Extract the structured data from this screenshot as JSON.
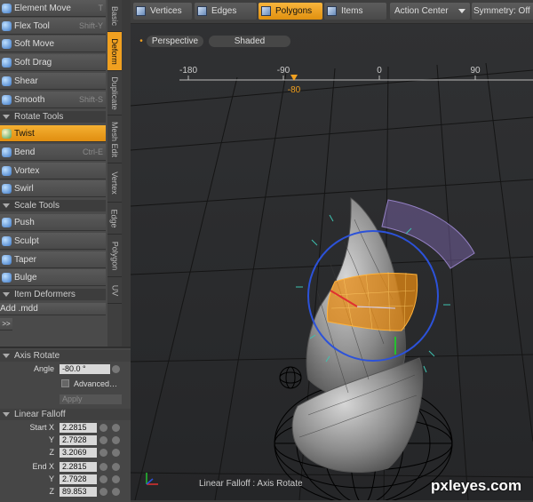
{
  "tool_panel": {
    "tools_top": [
      {
        "label": "Element Move",
        "shortcut": "T"
      },
      {
        "label": "Flex Tool",
        "shortcut": "Shift-Y"
      },
      {
        "label": "Soft Move",
        "shortcut": ""
      },
      {
        "label": "Soft Drag",
        "shortcut": ""
      },
      {
        "label": "Shear",
        "shortcut": ""
      },
      {
        "label": "Smooth",
        "shortcut": "Shift-S"
      }
    ],
    "rotate_header": "Rotate Tools",
    "rotate_tools": [
      {
        "label": "Twist",
        "shortcut": ""
      },
      {
        "label": "Bend",
        "shortcut": "Ctrl-E"
      },
      {
        "label": "Vortex",
        "shortcut": ""
      },
      {
        "label": "Swirl",
        "shortcut": ""
      }
    ],
    "scale_header": "Scale Tools",
    "scale_tools": [
      {
        "label": "Push"
      },
      {
        "label": "Sculpt"
      },
      {
        "label": "Taper"
      },
      {
        "label": "Bulge"
      }
    ],
    "deformers_header": "Item Deformers",
    "add_mdd": "Add .mdd",
    "expand": ">>"
  },
  "vertical_tabs": [
    "Basic",
    "Deform",
    "Duplicate",
    "Mesh Edit",
    "Vertex",
    "Edge",
    "Polygon",
    "UV"
  ],
  "properties": {
    "axis_rotate_header": "Axis Rotate",
    "angle_label": "Angle",
    "angle_value": "-80.0 °",
    "advanced_label": "Advanced…",
    "apply_label": "Apply",
    "falloff_header": "Linear Falloff",
    "start": {
      "label": "Start X",
      "x": "2.2815",
      "y": "2.7928",
      "z": "3.2069"
    },
    "end": {
      "label": "End X",
      "x": "2.2815",
      "y": "2.7928",
      "z": "89.853"
    },
    "axis_y": "Y",
    "axis_z": "Z"
  },
  "toolbar": {
    "vertices": "Vertices",
    "edges": "Edges",
    "polygons": "Polygons",
    "items": "Items",
    "action_center": "Action Center",
    "symmetry": "Symmetry: Off"
  },
  "viewport": {
    "view_mode": "Perspective",
    "shading": "Shaded",
    "ruler_ticks": [
      "-180",
      "-90",
      "0",
      "90"
    ],
    "ruler_marker": "-80",
    "status_text": "Linear Falloff : Axis Rotate",
    "watermark": "pxleyes.com"
  },
  "colors": {
    "accent": "#f0a020",
    "panel": "#4a4a4a",
    "viewport": "#2b2c2e"
  }
}
